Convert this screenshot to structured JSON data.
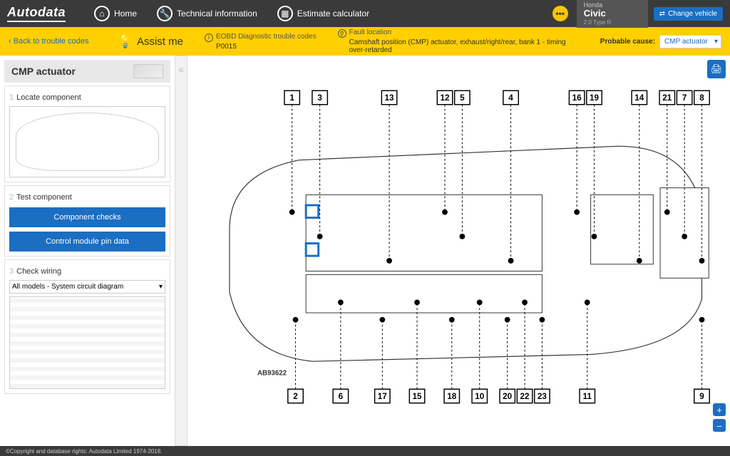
{
  "brand": "Autodata",
  "nav": {
    "home": "Home",
    "tech": "Technical information",
    "calc": "Estimate calculator"
  },
  "vehicle": {
    "make": "Honda",
    "model": "Civic",
    "variant": "2.0 Type R"
  },
  "change_vehicle": "Change vehicle",
  "yellow": {
    "back": "Back to trouble codes",
    "assist": "Assist me",
    "dtc_label": "EOBD Diagnostic trouble codes",
    "dtc_code": "P0015",
    "fault_label": "Fault location",
    "fault_text": "Camshaft position (CMP) actuator, exhaust/right/rear, bank 1 - timing over-retarded",
    "cause_label": "Probable cause:",
    "cause_value": "CMP actuator"
  },
  "sidebar": {
    "title": "CMP actuator",
    "step1": "Locate component",
    "step2": "Test component",
    "btn_checks": "Component checks",
    "btn_pins": "Control module pin data",
    "step3": "Check wiring",
    "wiring_select": "All models - System circuit diagram"
  },
  "diagram": {
    "ref": "AB93622",
    "top_callouts": [
      1,
      3,
      13,
      12,
      5,
      4,
      16,
      19,
      14,
      21,
      7,
      8
    ],
    "bottom_callouts": [
      2,
      6,
      17,
      15,
      18,
      10,
      20,
      22,
      23,
      11,
      9
    ]
  },
  "footer": "©Copyright and database rights: Autodata Limited 1974-2018."
}
